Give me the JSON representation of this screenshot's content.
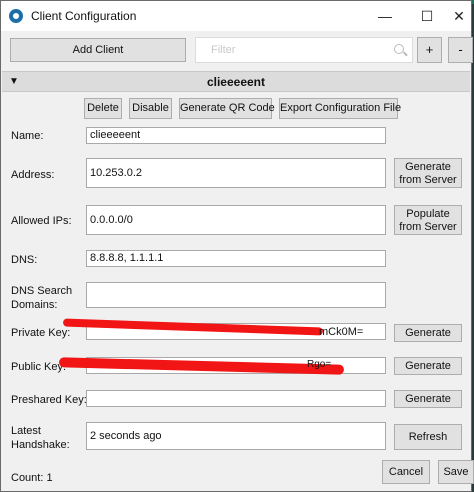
{
  "window": {
    "title": "Client Configuration",
    "controls": {
      "minimize": "—",
      "maximize": "☐",
      "close": "✕"
    }
  },
  "toolbar": {
    "add_client": "Add Client",
    "filter_placeholder": "Filter",
    "plus": "+",
    "minus": "-"
  },
  "client": {
    "header_name": "clieeeeent",
    "collapse_glyph": "▼",
    "actions": {
      "delete": "Delete",
      "disable": "Disable",
      "qr": "Generate QR Code",
      "export": "Export Configuration File"
    },
    "fields": {
      "name_label": "Name:",
      "name_value": "clieeeeent",
      "address_label": "Address:",
      "address_value": "10.253.0.2",
      "generate_from_server": "Generate from Server",
      "allowed_ips_label": "Allowed IPs:",
      "allowed_ips_value": "0.0.0.0/0",
      "populate_from_server": "Populate from Server",
      "dns_label": "DNS:",
      "dns_value": "8.8.8.8, 1.1.1.1",
      "dns_search_label": "DNS Search Domains:",
      "dns_search_value": "",
      "private_key_label": "Private Key:",
      "private_key_visible_tail": "mCk0M=",
      "public_key_label": "Public Key:",
      "public_key_visible_tail": "Rgo=",
      "preshared_key_label": "Preshared Key:",
      "preshared_key_value": "",
      "generate": "Generate",
      "latest_handshake_label": "Latest Handshake:",
      "latest_handshake_value": "2 seconds ago",
      "refresh": "Refresh"
    }
  },
  "footer": {
    "count": "Count: 1",
    "cancel": "Cancel",
    "save": "Save"
  },
  "colors": {
    "redaction": "#f21515",
    "window_bg": "#f0f0f0",
    "app_icon": "#1e6fa8"
  }
}
